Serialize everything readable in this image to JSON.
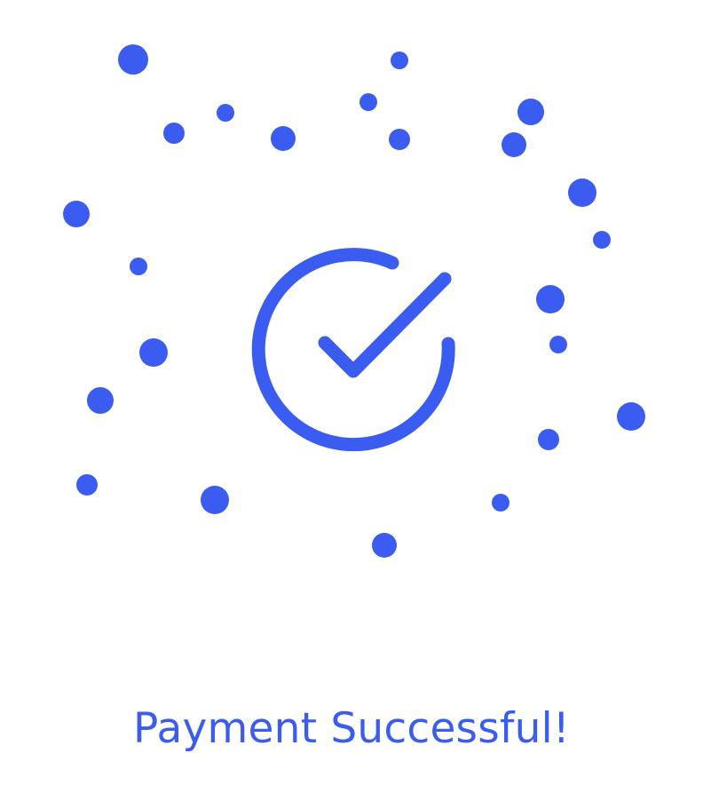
{
  "colors": {
    "accent": "#3b5cf0",
    "background": "#ffffff"
  },
  "icon": "check-circle-icon",
  "message": "Payment Successful!"
}
